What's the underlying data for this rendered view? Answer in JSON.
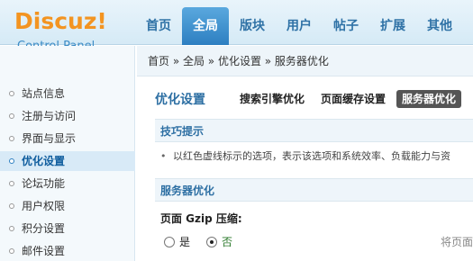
{
  "header": {
    "logo_title": "Discuz!",
    "logo_subtitle": "Control Panel",
    "tabs": [
      {
        "label": "首页"
      },
      {
        "label": "全局",
        "active": true
      },
      {
        "label": "版块"
      },
      {
        "label": "用户"
      },
      {
        "label": "帖子"
      },
      {
        "label": "扩展"
      },
      {
        "label": "其他"
      }
    ]
  },
  "breadcrumb": "首页 » 全局 » 优化设置 » 服务器优化",
  "sidebar": {
    "items": [
      {
        "label": "站点信息"
      },
      {
        "label": "注册与访问"
      },
      {
        "label": "界面与显示"
      },
      {
        "label": "优化设置",
        "active": true
      },
      {
        "label": "论坛功能"
      },
      {
        "label": "用户权限"
      },
      {
        "label": "积分设置"
      },
      {
        "label": "邮件设置"
      }
    ]
  },
  "main": {
    "title": "优化设置",
    "subtabs": [
      {
        "label": "搜索引擎优化"
      },
      {
        "label": "页面缓存设置"
      },
      {
        "label": "服务器优化",
        "active": true
      }
    ],
    "tips_header": "技巧提示",
    "tips_text": "以红色虚线标示的选项，表示该选项和系统效率、负载能力与资",
    "section_header": "服务器优化",
    "gzip_label": "页面 Gzip 压缩:",
    "radio_yes": "是",
    "radio_no": "否",
    "gzip_hint": "将页面"
  },
  "colors": {
    "logo_orange": "#f39421",
    "accent_blue": "#2d7fc1",
    "link_blue": "#2d6fa3"
  }
}
